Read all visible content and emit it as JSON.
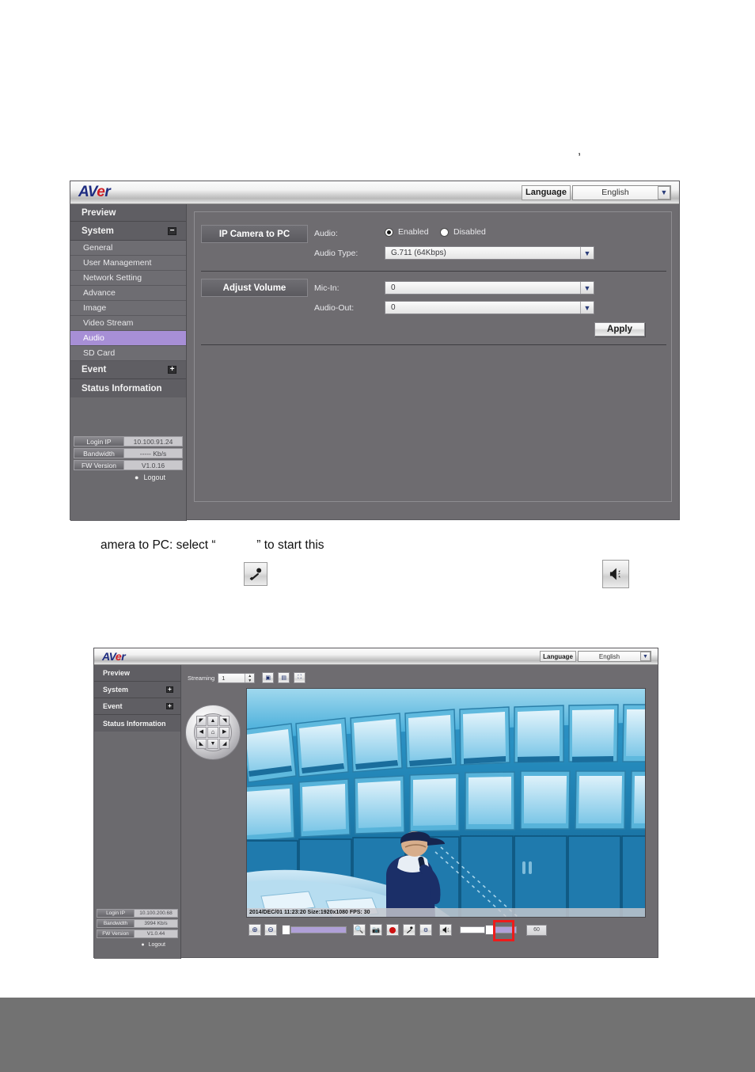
{
  "page": {
    "stray_mark": ",",
    "body_text": "amera to PC: select “            ” to start this"
  },
  "audio_page": {
    "titlebar": {
      "logo_text": "AVer",
      "logo_av": "AV",
      "logo_e": "e",
      "logo_r": "r",
      "language_label": "Language",
      "language_value": "English",
      "caret_icon": "chevron-down-icon"
    },
    "sidebar": {
      "items": [
        {
          "label": "Preview",
          "type": "group",
          "expander": null
        },
        {
          "label": "System",
          "type": "group",
          "expander": "−"
        },
        {
          "label": "General",
          "type": "sub",
          "active": false
        },
        {
          "label": "User Management",
          "type": "sub",
          "active": false
        },
        {
          "label": "Network Setting",
          "type": "sub",
          "active": false
        },
        {
          "label": "Advance",
          "type": "sub",
          "active": false
        },
        {
          "label": "Image",
          "type": "sub",
          "active": false
        },
        {
          "label": "Video Stream",
          "type": "sub",
          "active": false
        },
        {
          "label": "Audio",
          "type": "sub",
          "active": true
        },
        {
          "label": "SD Card",
          "type": "sub",
          "active": false
        },
        {
          "label": "Event",
          "type": "group",
          "expander": "+"
        },
        {
          "label": "Status Information",
          "type": "group",
          "expander": null
        }
      ],
      "info": [
        {
          "key": "Login IP",
          "value": "10.100.91.24"
        },
        {
          "key": "Bandwidth",
          "value": "----- Kb/s"
        },
        {
          "key": "FW Version",
          "value": "V1.0.16"
        }
      ],
      "logout_label": "Logout",
      "logout_icon": "person-icon"
    },
    "sections": {
      "ip_camera_to_pc": {
        "heading": "IP Camera to PC",
        "audio_label": "Audio:",
        "radio_enabled": "Enabled",
        "radio_disabled": "Disabled",
        "selected": "Enabled",
        "audio_type_label": "Audio Type:",
        "audio_type_value": "G.711 (64Kbps)"
      },
      "adjust_volume": {
        "heading": "Adjust Volume",
        "mic_in_label": "Mic-In:",
        "mic_in_value": "0",
        "audio_out_label": "Audio-Out:",
        "audio_out_value": "0"
      },
      "apply_label": "Apply"
    }
  },
  "doc_icons": {
    "microphone": "microphone-icon",
    "speaker": "speaker-icon"
  },
  "live_page": {
    "titlebar": {
      "logo_text": "AVer",
      "logo_av": "AV",
      "logo_e": "e",
      "logo_r": "r",
      "language_label": "Language",
      "language_value": "English",
      "caret_icon": "chevron-down-icon"
    },
    "sidebar": {
      "items": [
        {
          "label": "Preview",
          "expander": null
        },
        {
          "label": "System",
          "expander": "+"
        },
        {
          "label": "Event",
          "expander": "+"
        },
        {
          "label": "Status Information",
          "expander": null
        }
      ],
      "info": [
        {
          "key": "Login IP",
          "value": "10.100.200.68"
        },
        {
          "key": "Bandwidth",
          "value": "3994 Kb/s"
        },
        {
          "key": "FW Version",
          "value": "V1.0.44"
        }
      ],
      "logout_label": "Logout",
      "logout_icon": "person-icon"
    },
    "toolbar_top": {
      "streaming_label": "Streaming",
      "streaming_value": "1",
      "view_buttons": [
        {
          "name": "original-size-button",
          "glyph": "▣"
        },
        {
          "name": "fit-window-button",
          "glyph": "▤"
        },
        {
          "name": "full-screen-button",
          "glyph": "⛶"
        }
      ]
    },
    "ptz": {
      "name": "ptz-pad",
      "home_icon": "home-icon",
      "arrows": [
        "◤",
        "▲",
        "◥",
        "◀",
        "home",
        "▶",
        "◣",
        "▼",
        "◢"
      ]
    },
    "video": {
      "status_text": "2014/DEC/01 11:23:20 Size:1920x1080 FPS: 30",
      "scene": "control-room-video-wall"
    },
    "toolbar_bottom": {
      "buttons": [
        {
          "name": "zoom-in-button",
          "icon": "zoom-in-icon"
        },
        {
          "name": "zoom-out-button",
          "icon": "zoom-out-icon"
        },
        {
          "name": "digital-zoom-button",
          "icon": "magnifier-icon"
        },
        {
          "name": "snapshot-button",
          "icon": "camera-icon"
        },
        {
          "name": "record-button",
          "icon": "record-dot-icon"
        },
        {
          "name": "microphone-button",
          "icon": "microphone-icon"
        },
        {
          "name": "video-settings-button",
          "icon": "gear-video-icon"
        },
        {
          "name": "speaker-button",
          "icon": "speaker-icon",
          "highlighted": true
        }
      ],
      "zoom_slider_value": 12,
      "volume_slider_value": 55,
      "volume_number": "60"
    },
    "highlight_color": "#ee1b1b"
  }
}
